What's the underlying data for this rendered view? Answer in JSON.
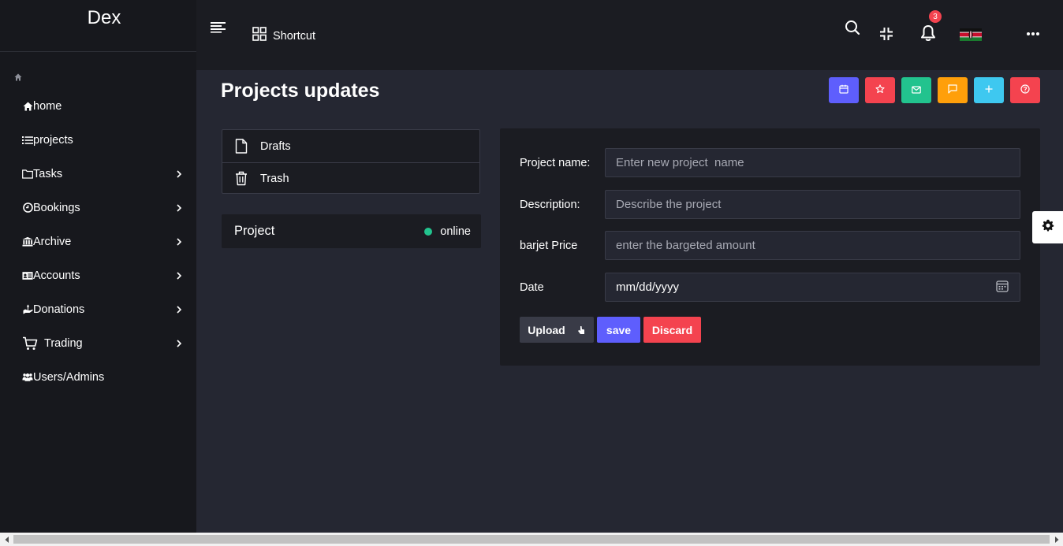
{
  "brand": {
    "name": "Dex"
  },
  "sidebar": {
    "items": [
      {
        "label": "home",
        "icon": "home-icon",
        "has_children": false
      },
      {
        "label": "projects",
        "icon": "list-icon",
        "has_children": false
      },
      {
        "label": "Tasks",
        "icon": "folder-icon",
        "has_children": true
      },
      {
        "label": "Bookings",
        "icon": "clock-icon",
        "has_children": true
      },
      {
        "label": "Archive",
        "icon": "bank-icon",
        "has_children": true
      },
      {
        "label": "Accounts",
        "icon": "id-card-icon",
        "has_children": true
      },
      {
        "label": "Donations",
        "icon": "hand-holding-icon",
        "has_children": true
      },
      {
        "label": "Trading",
        "icon": "cart-icon",
        "has_children": true
      },
      {
        "label": "Users/Admins",
        "icon": "users-icon",
        "has_children": false
      }
    ]
  },
  "header": {
    "shortcut_label": "Shortcut",
    "notification_count": "3",
    "language_flag": "kenya-flag"
  },
  "page": {
    "title": "Projects updates",
    "quick_actions": [
      {
        "icon": "calendar-icon",
        "color": "#5e5efd"
      },
      {
        "icon": "star-icon",
        "color": "#f4434f"
      },
      {
        "icon": "mail-icon",
        "color": "#22c38e"
      },
      {
        "icon": "chat-icon",
        "color": "#ff9f0a"
      },
      {
        "icon": "plus-icon",
        "color": "#3ec8f0"
      },
      {
        "icon": "help-icon",
        "color": "#f4434f"
      }
    ]
  },
  "folders": [
    {
      "label": "Drafts",
      "icon": "file-icon"
    },
    {
      "label": "Trash",
      "icon": "trash-icon"
    }
  ],
  "project": {
    "name": "Project",
    "status": "online",
    "status_color": "#22c38e"
  },
  "form": {
    "name_label": "Project name:",
    "name_placeholder": "Enter new project  name",
    "description_label": "Description:",
    "description_placeholder": "Describe the project",
    "price_label": "barjet Price",
    "price_placeholder": "enter the bargeted amount",
    "date_label": "Date",
    "date_value": "mm/dd/yyyy",
    "upload_label": "Upload",
    "save_label": "save",
    "discard_label": "Discard"
  },
  "colors": {
    "sidebar_bg": "#17181d",
    "main_bg": "#252732",
    "card_bg": "#1b1c22",
    "primary": "#5e5efd",
    "danger": "#f4434f"
  }
}
